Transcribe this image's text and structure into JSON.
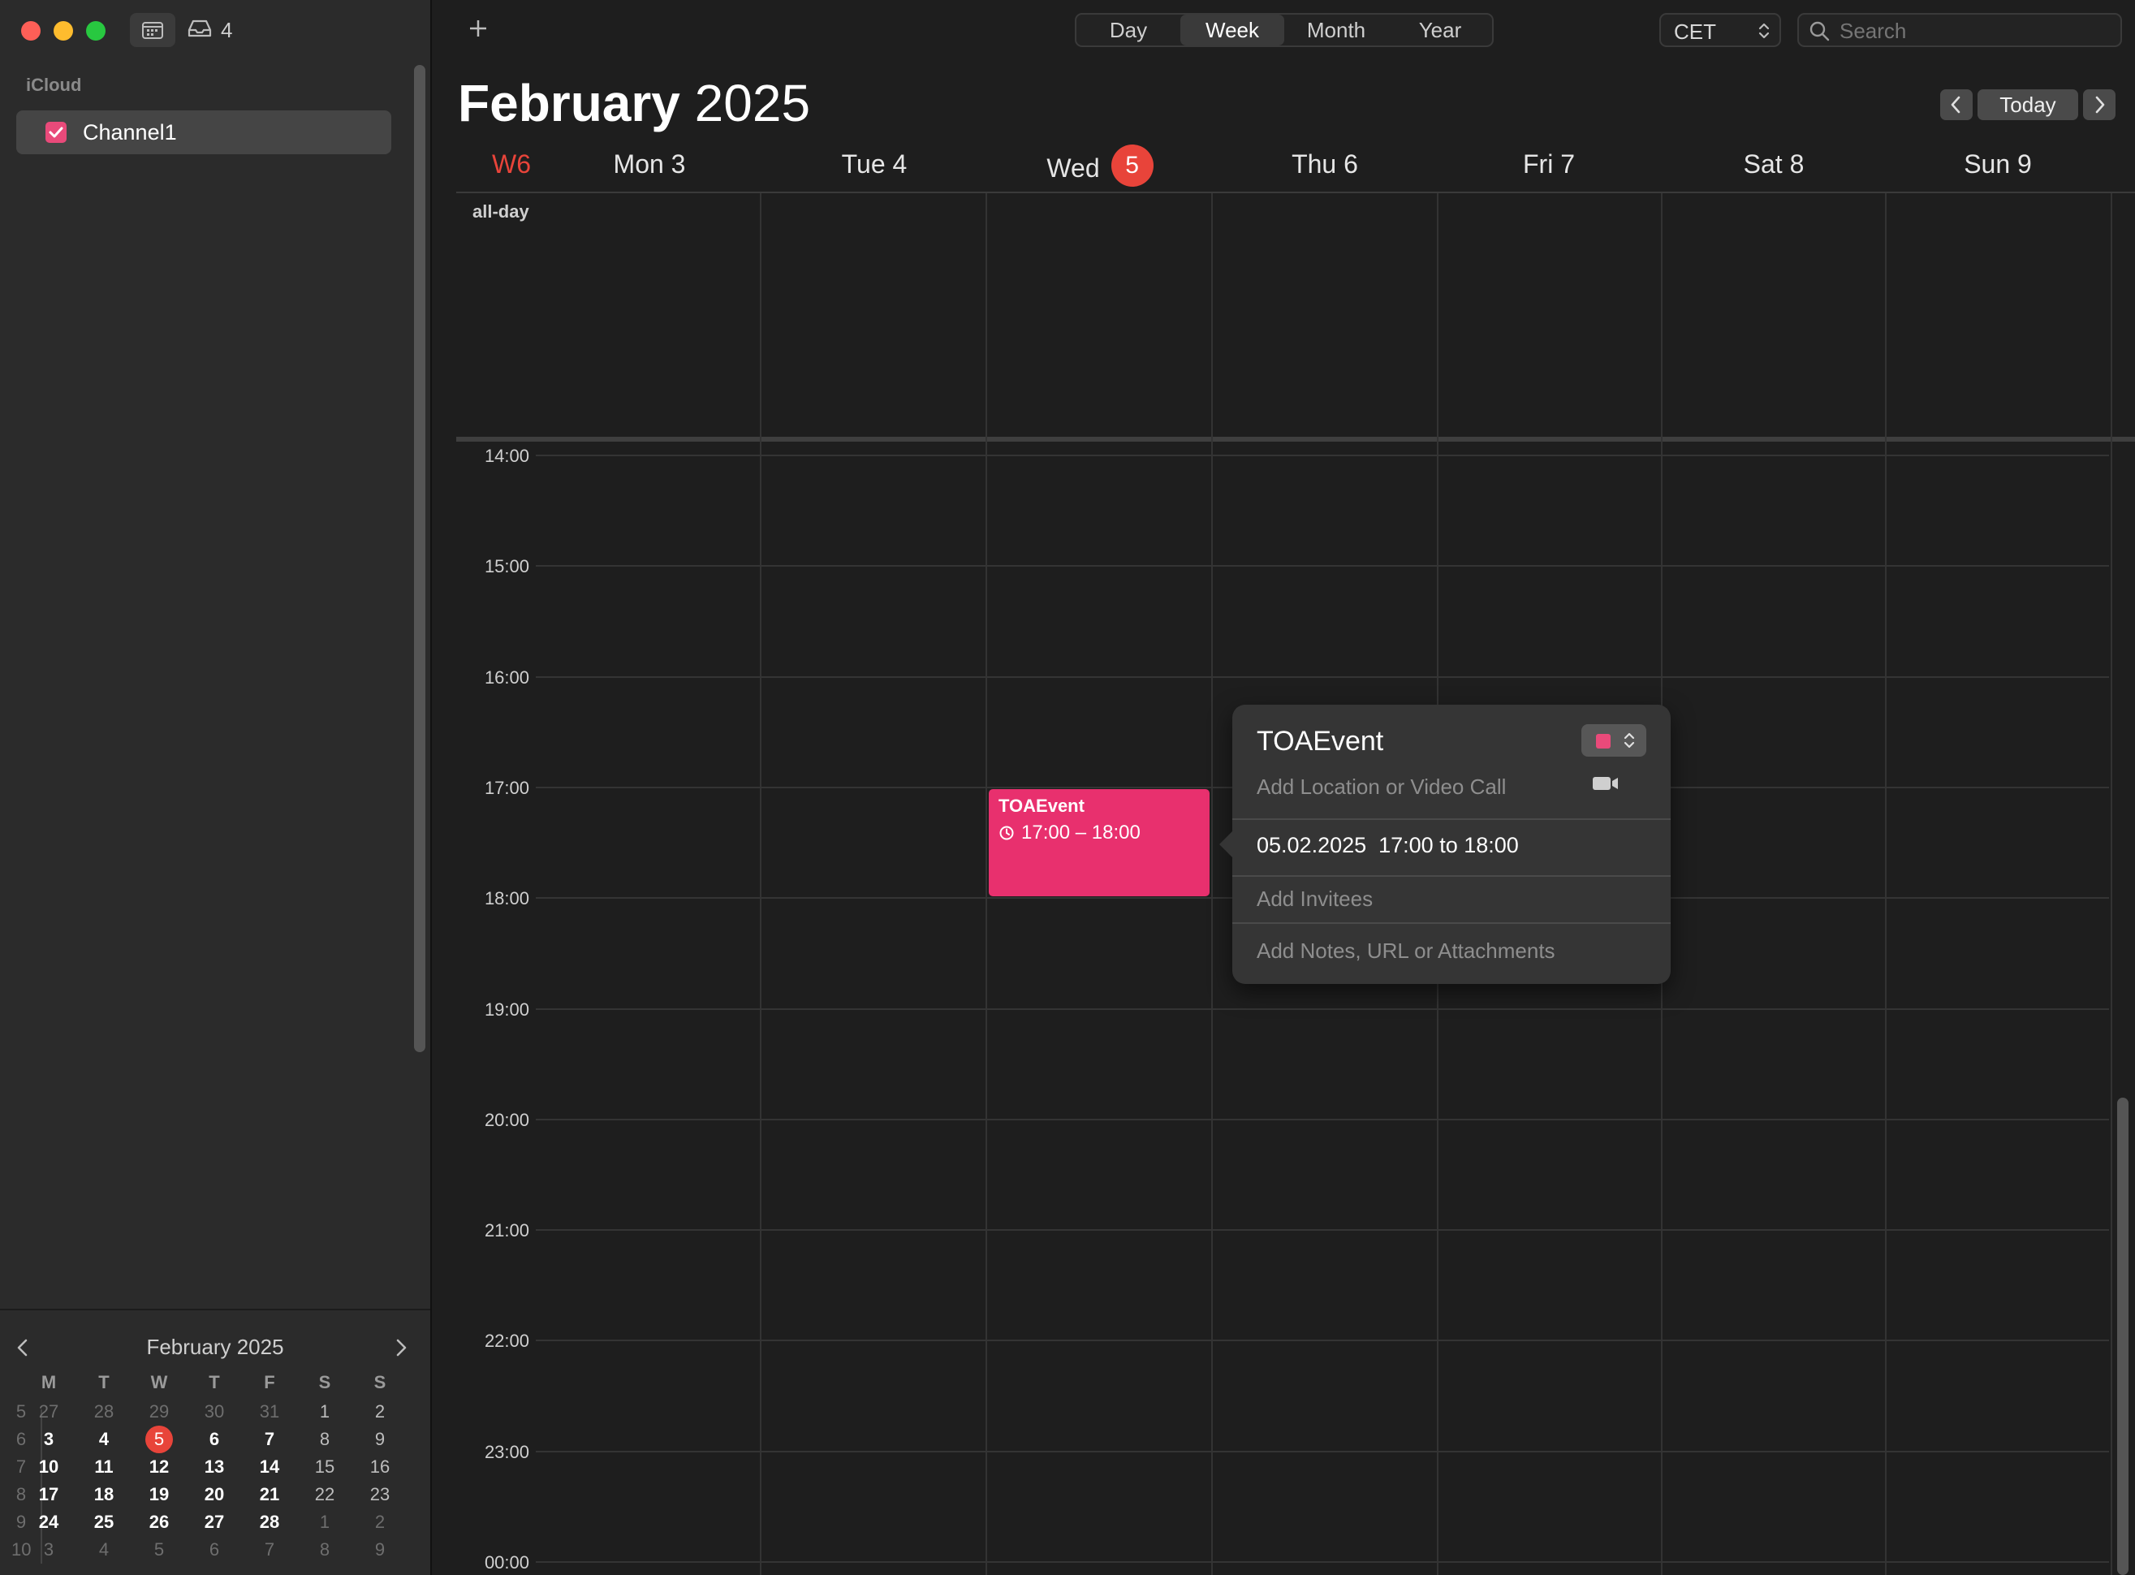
{
  "toolbar": {
    "inbox_count": "4",
    "add_label": "+",
    "views": [
      "Day",
      "Week",
      "Month",
      "Year"
    ],
    "active_view": "Week",
    "timezone": "CET",
    "search_placeholder": "Search",
    "today_label": "Today"
  },
  "sidebar": {
    "account": "iCloud",
    "calendars": [
      {
        "name": "Channel1",
        "color": "#e94a7a",
        "checked": true
      }
    ]
  },
  "header": {
    "month": "February",
    "year": "2025",
    "week_label": "W6"
  },
  "days": [
    {
      "label": "Mon 3"
    },
    {
      "label": "Tue 4"
    },
    {
      "label": "Wed",
      "badge": "5"
    },
    {
      "label": "Thu 6"
    },
    {
      "label": "Fri 7"
    },
    {
      "label": "Sat 8"
    },
    {
      "label": "Sun 9"
    }
  ],
  "allday_label": "all-day",
  "times": [
    "14:00",
    "15:00",
    "16:00",
    "17:00",
    "18:00",
    "19:00",
    "20:00",
    "21:00",
    "22:00",
    "23:00",
    "00:00"
  ],
  "event": {
    "title": "TOAEvent",
    "time": "17:00 – 18:00",
    "color": "#e8306e"
  },
  "popover": {
    "title": "TOAEvent",
    "location_placeholder": "Add Location or Video Call",
    "datetime": "05.02.2025  17:00 to 18:00",
    "invitees_placeholder": "Add Invitees",
    "notes_placeholder": "Add Notes, URL or Attachments",
    "color": "#e94a7a"
  },
  "mini_calendar": {
    "title": "February 2025",
    "weekday_headers": [
      "M",
      "T",
      "W",
      "T",
      "F",
      "S",
      "S"
    ],
    "weeks": [
      {
        "num": "5",
        "days": [
          "27",
          "28",
          "29",
          "30",
          "31",
          "1",
          "2"
        ]
      },
      {
        "num": "6",
        "days": [
          "3",
          "4",
          "5",
          "6",
          "7",
          "8",
          "9"
        ]
      },
      {
        "num": "7",
        "days": [
          "10",
          "11",
          "12",
          "13",
          "14",
          "15",
          "16"
        ]
      },
      {
        "num": "8",
        "days": [
          "17",
          "18",
          "19",
          "20",
          "21",
          "22",
          "23"
        ]
      },
      {
        "num": "9",
        "days": [
          "24",
          "25",
          "26",
          "27",
          "28",
          "1",
          "2"
        ]
      },
      {
        "num": "10",
        "days": [
          "3",
          "4",
          "5",
          "6",
          "7",
          "8",
          "9"
        ]
      }
    ],
    "today": "5"
  }
}
